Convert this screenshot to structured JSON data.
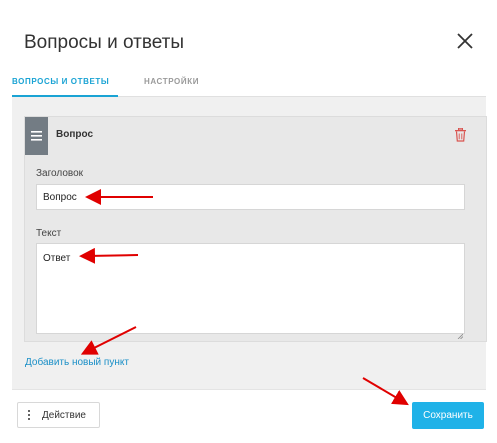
{
  "dialog": {
    "title": "Вопросы и ответы",
    "close_icon": "close-icon"
  },
  "tabs": [
    {
      "label": "ВОПРОСЫ И ОТВЕТЫ",
      "active": true
    },
    {
      "label": "НАСТРОЙКИ",
      "active": false
    }
  ],
  "item": {
    "title": "Вопрос",
    "handle_icon": "drag-handle-icon",
    "delete_icon": "trash-icon",
    "heading_label": "Заголовок",
    "heading_value": "Вопрос",
    "text_label": "Текст",
    "text_value": "Ответ"
  },
  "add_item_label": "Добавить новый пункт",
  "footer": {
    "action_label": "Действие",
    "save_label": "Сохранить"
  },
  "colors": {
    "accent": "#1aa3d4",
    "save_button": "#1fb2e8",
    "annotation_arrow": "#e00000",
    "delete_icon": "#d9534f"
  }
}
